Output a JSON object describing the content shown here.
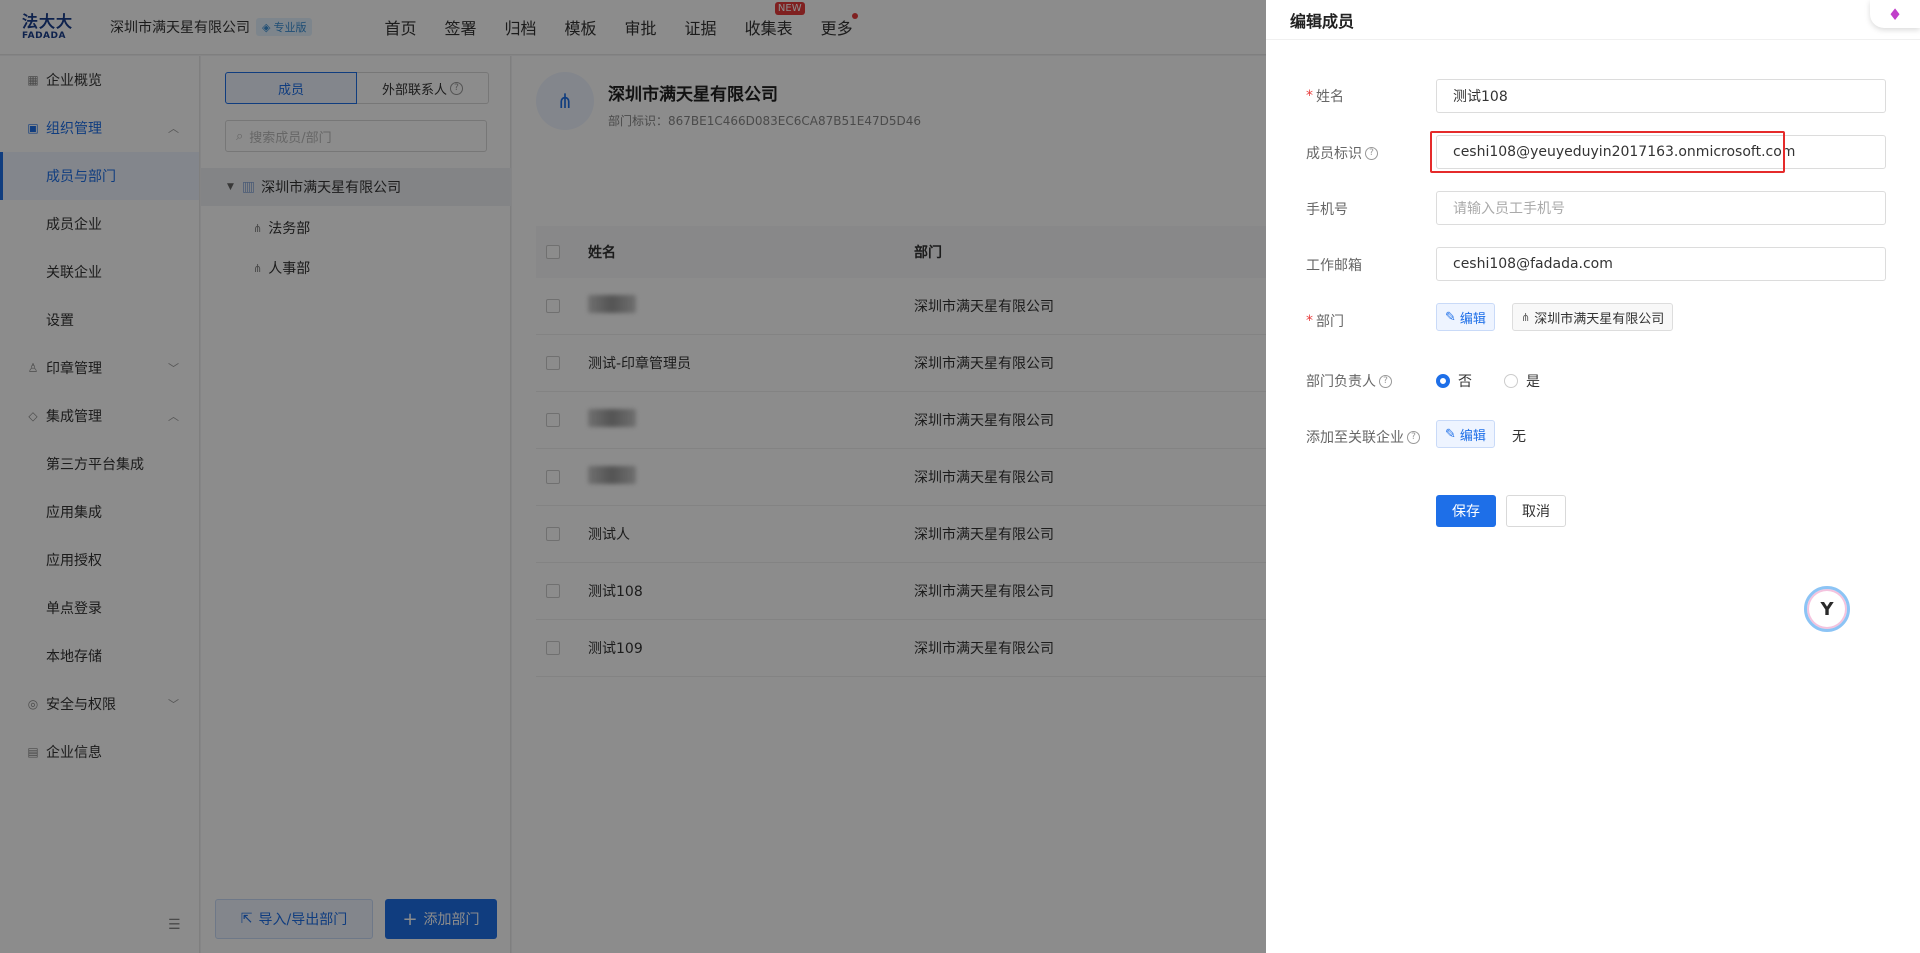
{
  "topbar": {
    "logo_line1": "法大大",
    "logo_line2": "FADADA",
    "company": "深圳市满天星有限公司",
    "edition": "专业版",
    "nav": [
      "首页",
      "签署",
      "归档",
      "模板",
      "审批",
      "证据",
      "收集表",
      "更多"
    ],
    "new_badge": "NEW"
  },
  "sidebar": {
    "items": [
      {
        "label": "企业概览"
      },
      {
        "label": "组织管理"
      },
      {
        "label": "成员与部门"
      },
      {
        "label": "成员企业"
      },
      {
        "label": "关联企业"
      },
      {
        "label": "设置"
      },
      {
        "label": "印章管理"
      },
      {
        "label": "集成管理"
      },
      {
        "label": "第三方平台集成"
      },
      {
        "label": "应用集成"
      },
      {
        "label": "应用授权"
      },
      {
        "label": "单点登录"
      },
      {
        "label": "本地存储"
      },
      {
        "label": "安全与权限"
      },
      {
        "label": "企业信息"
      }
    ]
  },
  "deptpanel": {
    "tab_members": "成员",
    "tab_external": "外部联系人",
    "search_placeholder": "搜索成员/部门",
    "root": "深圳市满天星有限公司",
    "children": [
      "法务部",
      "人事部"
    ],
    "import_export": "导入/导出部门",
    "add_dept": "添加部门"
  },
  "main": {
    "dept_title": "深圳市满天星有限公司",
    "dept_id": "部门标识：867BE1C466D083EC6CA87B51E47D5D46",
    "columns": [
      "姓名",
      "部门"
    ],
    "rows": [
      {
        "name": "",
        "dept": "深圳市满天星有限公司"
      },
      {
        "name": "测试-印章管理员",
        "dept": "深圳市满天星有限公司"
      },
      {
        "name": "",
        "dept": "深圳市满天星有限公司"
      },
      {
        "name": "",
        "dept": "深圳市满天星有限公司"
      },
      {
        "name": "测试人",
        "dept": "深圳市满天星有限公司"
      },
      {
        "name": "测试108",
        "dept": "深圳市满天星有限公司"
      },
      {
        "name": "测试109",
        "dept": "深圳市满天星有限公司"
      }
    ]
  },
  "drawer": {
    "title": "编辑成员",
    "name_label": "姓名",
    "name_value": "测试108",
    "member_id_label": "成员标识",
    "member_id_value": "ceshi108@yeuyeduyin2017163.onmicrosoft.com",
    "phone_label": "手机号",
    "phone_placeholder": "请输入员工手机号",
    "email_label": "工作邮箱",
    "email_value": "ceshi108@fadada.com",
    "dept_label": "部门",
    "edit_label": "编辑",
    "dept_tag": "深圳市满天星有限公司",
    "leader_label": "部门负责人",
    "leader_no": "否",
    "leader_yes": "是",
    "assoc_label": "添加至关联企业",
    "assoc_value": "无",
    "save": "保存",
    "cancel": "取消"
  }
}
